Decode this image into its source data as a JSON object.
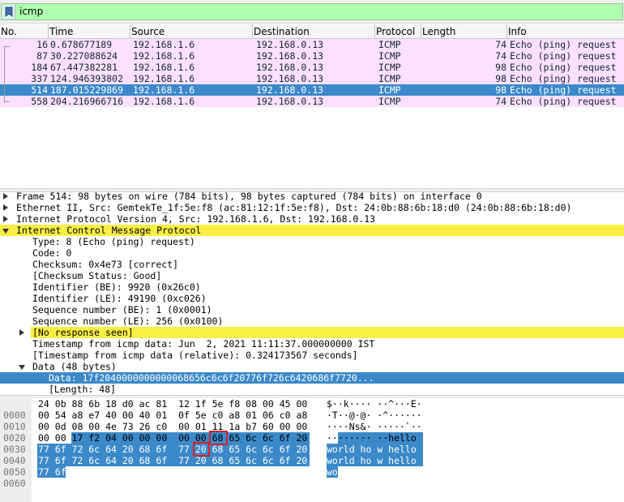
{
  "filter": {
    "text": "icmp",
    "bg_color": "#afffaf"
  },
  "packet_list": {
    "columns": [
      "No.",
      "Time",
      "Source",
      "Destination",
      "Protocol",
      "Length",
      "Info"
    ],
    "rows": [
      {
        "no": "16",
        "time": "0.678677189",
        "source": "192.168.1.6",
        "destination": "192.168.0.13",
        "protocol": "ICMP",
        "length": "74",
        "info": "Echo (ping) request"
      },
      {
        "no": "87",
        "time": "30.227088624",
        "source": "192.168.1.6",
        "destination": "192.168.0.13",
        "protocol": "ICMP",
        "length": "74",
        "info": "Echo (ping) request"
      },
      {
        "no": "184",
        "time": "67.447382281",
        "source": "192.168.1.6",
        "destination": "192.168.0.13",
        "protocol": "ICMP",
        "length": "98",
        "info": "Echo (ping) request"
      },
      {
        "no": "337",
        "time": "124.946393802",
        "source": "192.168.1.6",
        "destination": "192.168.0.13",
        "protocol": "ICMP",
        "length": "98",
        "info": "Echo (ping) request"
      },
      {
        "no": "514",
        "time": "187.015229869",
        "source": "192.168.1.6",
        "destination": "192.168.0.13",
        "protocol": "ICMP",
        "length": "98",
        "info": "Echo (ping) request"
      },
      {
        "no": "558",
        "time": "204.216966716",
        "source": "192.168.1.6",
        "destination": "192.168.0.13",
        "protocol": "ICMP",
        "length": "74",
        "info": "Echo (ping) request"
      }
    ],
    "selected_row": 4,
    "row_color": "#fce0ff",
    "selected_color": "#3b89c9"
  },
  "details": {
    "lines": [
      {
        "text": "Frame 514: 98 bytes on wire (784 bits), 98 bytes captured (784 bits) on interface 0",
        "expander": "collapsed"
      },
      {
        "text": "Ethernet II, Src: GemtekTe_1f:5e:f8 (ac:81:12:1f:5e:f8), Dst: 24:0b:88:6b:18:d0 (24:0b:88:6b:18:d0)",
        "expander": "collapsed"
      },
      {
        "text": "Internet Protocol Version 4, Src: 192.168.1.6, Dst: 192.168.0.13",
        "expander": "collapsed"
      },
      {
        "text": "Internet Control Message Protocol",
        "expander": "expanded"
      },
      {
        "text": "Type: 8 (Echo (ping) request)",
        "expander": "none"
      },
      {
        "text": "Code: 0",
        "expander": "none"
      },
      {
        "text": "Checksum: 0x4e73 [correct]",
        "expander": "none"
      },
      {
        "text": "[Checksum Status: Good]",
        "expander": "none"
      },
      {
        "text": "Identifier (BE): 9920 (0x26c0)",
        "expander": "none"
      },
      {
        "text": "Identifier (LE): 49190 (0xc026)",
        "expander": "none"
      },
      {
        "text": "Sequence number (BE): 1 (0x0001)",
        "expander": "none"
      },
      {
        "text": "Sequence number (LE): 256 (0x0100)",
        "expander": "none"
      },
      {
        "text": "[No response seen]",
        "expander": "collapsed"
      },
      {
        "text": "Timestamp from icmp data: Jun  2, 2021 11:11:37.000000000 IST",
        "expander": "none"
      },
      {
        "text": "[Timestamp from icmp data (relative): 0.324173567 seconds]",
        "expander": "none"
      },
      {
        "text": "Data (48 bytes)",
        "expander": "expanded"
      },
      {
        "text": "Data: 17f2040000000000068656c6c6f20776f726c6420686f7720...",
        "expander": "none"
      },
      {
        "text": "[Length: 48]",
        "expander": "none"
      }
    ],
    "highlight_color": "#f8ee44"
  },
  "bytes": {
    "rows": [
      {
        "offset": "0000",
        "hex": "24 0b 88 6b 18 d0 ac 81  12 1f 5e f8 08 00 45 00",
        "ascii": "$··k···· ··^···E·"
      },
      {
        "offset": "0010",
        "hex": "00 54 a8 e7 40 00 40 01  0f 5e c0 a8 01 06 c0 a8",
        "ascii": "·T··@·@· ·^······"
      },
      {
        "offset": "0020",
        "hex": "00 0d 08 00 4e 73 26 c0  00 01 11 1a b7 60 00 00",
        "ascii": "····Ns&· ·····`··"
      },
      {
        "offset": "0030",
        "hex": "00 00 17 f2 04 00 00 00  00 00 68 65 6c 6c 6f 20",
        "ascii": "········ ··hello "
      },
      {
        "offset": "0040",
        "hex": "77 6f 72 6c 64 20 68 6f  77 20 68 65 6c 6c 6f 20",
        "ascii": "world ho w hello "
      },
      {
        "offset": "0050",
        "hex": "77 6f 72 6c 64 20 68 6f  77 20 68 65 6c 6c 6f 20",
        "ascii": "world ho w hello "
      },
      {
        "offset": "0060",
        "hex": "77 6f",
        "ascii": "wo"
      }
    ]
  }
}
